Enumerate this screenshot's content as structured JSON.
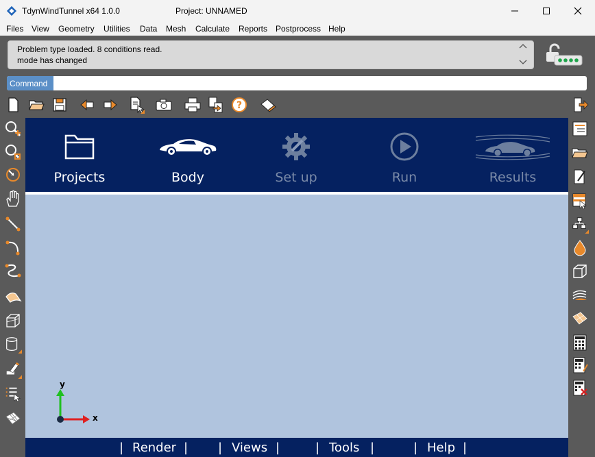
{
  "window": {
    "app_title": "TdynWindTunnel x64 1.0.0",
    "project_title": "Project: UNNAMED"
  },
  "menu": [
    "Files",
    "View",
    "Geometry",
    "Utilities",
    "Data",
    "Mesh",
    "Calculate",
    "Reports",
    "Postprocess",
    "Help"
  ],
  "messages": {
    "line1": "Problem type loaded. 8 conditions read.",
    "line2": "mode has changed"
  },
  "command": {
    "label": "Command",
    "value": ""
  },
  "panel": {
    "tabs": [
      {
        "label": "Projects",
        "icon": "folder-icon",
        "active": true
      },
      {
        "label": "Body",
        "icon": "car-icon",
        "active": true
      },
      {
        "label": "Set up",
        "icon": "gear-wrench-icon",
        "active": false
      },
      {
        "label": "Run",
        "icon": "play-icon",
        "active": false
      },
      {
        "label": "Results",
        "icon": "car-flow-icon",
        "active": false
      }
    ]
  },
  "axes": {
    "x": "x",
    "y": "y"
  },
  "bottom_bar": {
    "items": [
      "Render",
      "Views",
      "Tools",
      "Help"
    ],
    "separator": "|"
  },
  "colors": {
    "panel_bg": "#052160",
    "viewport_bg": "#b0c4de",
    "accent_orange": "#e8892b",
    "disabled_text": "#7a8aa8"
  }
}
